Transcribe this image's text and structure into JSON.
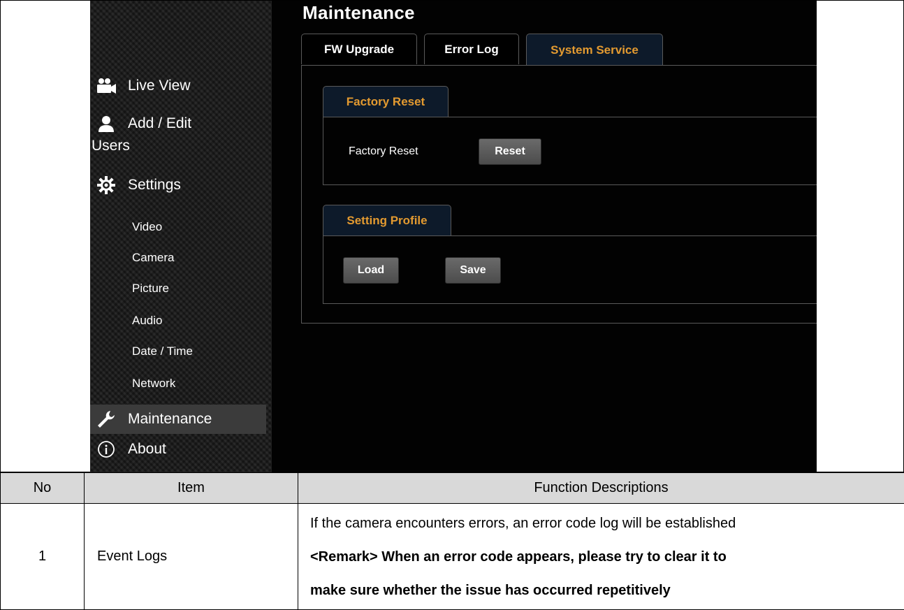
{
  "screenshot": {
    "page_title": "Maintenance",
    "sidebar": {
      "live_view": "Live View",
      "add_edit": "Add / Edit",
      "users": "Users",
      "settings": "Settings",
      "sub_items": [
        "Video",
        "Camera",
        "Picture",
        "Audio",
        "Date / Time",
        "Network"
      ],
      "maintenance": "Maintenance",
      "about": "About"
    },
    "tabs": [
      {
        "label": "FW Upgrade",
        "active": false
      },
      {
        "label": "Error Log",
        "active": false
      },
      {
        "label": "System Service",
        "active": true
      }
    ],
    "factory_reset": {
      "group_label": "Factory Reset",
      "row_label": "Factory Reset",
      "button": "Reset"
    },
    "setting_profile": {
      "group_label": "Setting Profile",
      "load_button": "Load",
      "save_button": "Save"
    },
    "colors": {
      "accent": "#e39a30",
      "background": "#000000",
      "border": "#5a5a5a"
    }
  },
  "table": {
    "headers": [
      "No",
      "Item",
      "Function Descriptions"
    ],
    "rows": [
      {
        "no": "1",
        "item": "Event Logs",
        "desc_line1": "If the camera encounters errors, an error code log will be established",
        "desc_line2": "<Remark> When an error code appears, please try to clear it to",
        "desc_line3": "make sure whether the issue has occurred repetitively"
      }
    ]
  }
}
